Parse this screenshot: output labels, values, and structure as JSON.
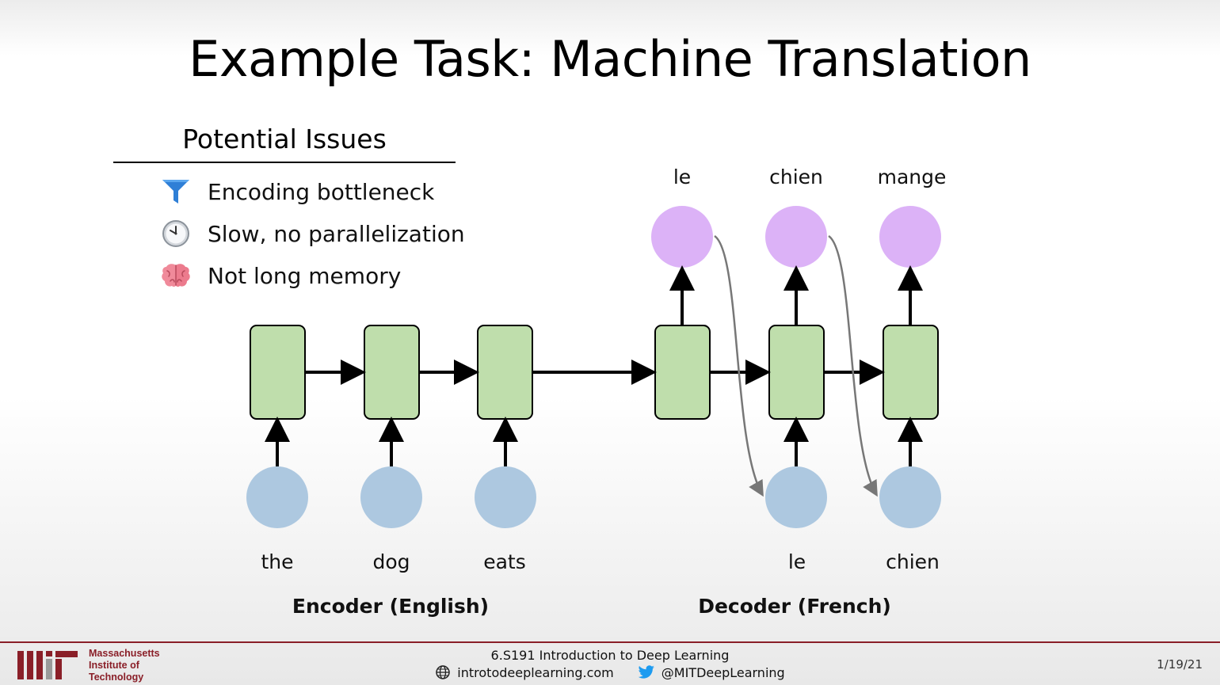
{
  "slide": {
    "title": "Example Task: Machine Translation"
  },
  "issues": {
    "header": "Potential Issues",
    "items": [
      {
        "icon": "funnel-icon",
        "label": "Encoding bottleneck"
      },
      {
        "icon": "clock-icon",
        "label": "Slow, no parallelization"
      },
      {
        "icon": "brain-icon",
        "label": "Not long memory"
      }
    ]
  },
  "diagram": {
    "encoder_inputs": [
      "the",
      "dog",
      "eats"
    ],
    "decoder_inputs": [
      "le",
      "chien"
    ],
    "decoder_outputs": [
      "le",
      "chien",
      "mange"
    ],
    "encoder_label": "Encoder (English)",
    "decoder_label": "Decoder (French)",
    "colors": {
      "cell": "#bfdeac",
      "input": "#adc8e0",
      "output": "#dcb2f7",
      "arrow": "#000000",
      "feedback_arrow": "#777777"
    }
  },
  "footer": {
    "institution": [
      "Massachusetts",
      "Institute of",
      "Technology"
    ],
    "course": "6.S191 Introduction to Deep Learning",
    "website": "introtodeeplearning.com",
    "twitter": "@MITDeepLearning",
    "date": "1/19/21",
    "accent": "#8a1f28"
  }
}
